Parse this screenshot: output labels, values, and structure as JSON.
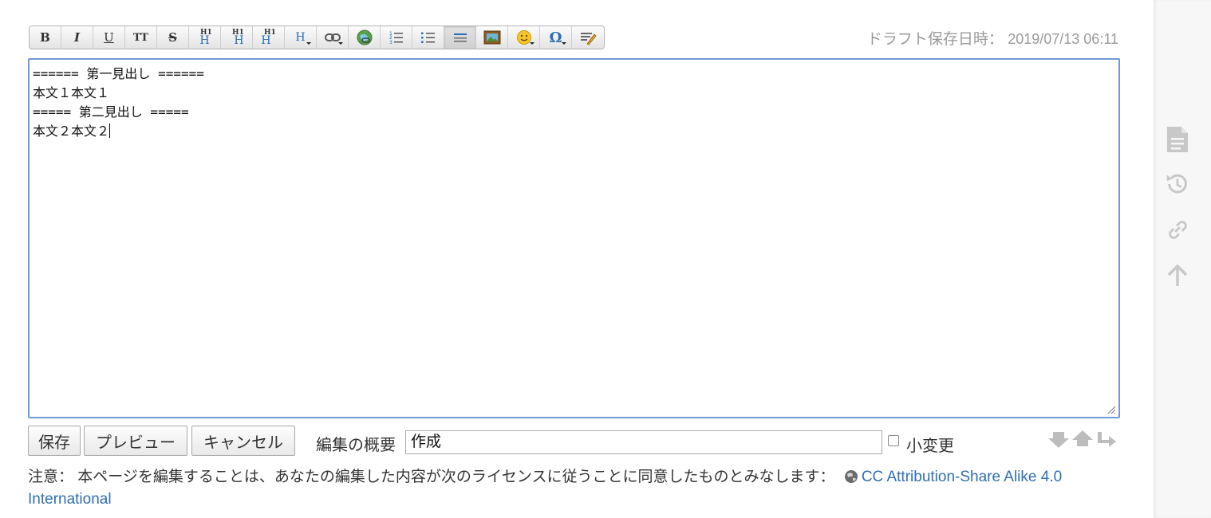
{
  "toolbar": {
    "buttons": [
      {
        "name": "bold",
        "label": "B"
      },
      {
        "name": "italic",
        "label": "I"
      },
      {
        "name": "underline",
        "label": "U"
      },
      {
        "name": "monospace",
        "label": "TT"
      },
      {
        "name": "strikethrough",
        "label": "S"
      },
      {
        "name": "heading-same",
        "label": "H"
      },
      {
        "name": "heading-lower",
        "label": "H"
      },
      {
        "name": "heading-higher",
        "label": "H"
      },
      {
        "name": "heading-select",
        "label": "H"
      },
      {
        "name": "internal-link",
        "label": ""
      },
      {
        "name": "external-link",
        "label": ""
      },
      {
        "name": "ordered-list",
        "label": ""
      },
      {
        "name": "unordered-list",
        "label": ""
      },
      {
        "name": "horizontal-rule",
        "label": ""
      },
      {
        "name": "media",
        "label": ""
      },
      {
        "name": "smiley",
        "label": ""
      },
      {
        "name": "special-chars",
        "label": "Ω"
      },
      {
        "name": "signature",
        "label": ""
      }
    ]
  },
  "draft": {
    "label": "ドラフト保存日時：",
    "timestamp": "2019/07/13 06:11"
  },
  "editor": {
    "lines": [
      "====== 第一見出し ======",
      "本文１本文１",
      "===== 第二見出し =====",
      "本文２本文２"
    ]
  },
  "buttons": {
    "save": "保存",
    "preview": "プレビュー",
    "cancel": "キャンセル"
  },
  "summary": {
    "label": "編集の概要",
    "value": "作成"
  },
  "minor": {
    "label": "小変更",
    "checked": false
  },
  "notice": {
    "text": "注意： 本ページを編集することは、あなたの編集した内容が次のライセンスに従うことに同意したものとみなします：",
    "license_link": "CC Attribution-Share Alike 4.0 International"
  },
  "rail": {
    "icons": [
      "page-icon",
      "history-icon",
      "link-icon",
      "back-to-top-icon"
    ]
  },
  "colors": {
    "editor_border": "#6f9ad3",
    "link": "#2f6fb2",
    "rail_icon": "#c8c8c8"
  }
}
